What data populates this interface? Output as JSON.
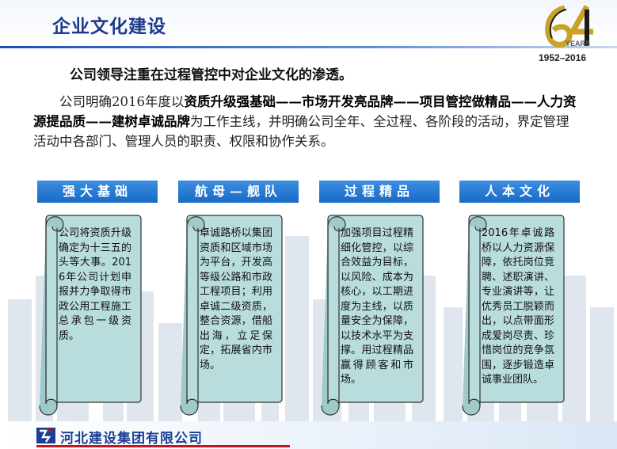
{
  "header": {
    "title": "企业文化建设",
    "years_label": "YEARS",
    "years_range": "1952–2016"
  },
  "intro": "公司领导注重在过程管控中对企业文化的渗透。",
  "paragraph": {
    "p1": "公司明确2016年度以",
    "b1": "资质升级强基础——市场开发亮品牌——项目管控做精品——人力资源提品质——建树卓诚品牌",
    "p2": "为工作主线，并明确公司全年、全过程、各阶段的活动，界定管理活动中各部门、管理人员的职责、权限和协作关系。"
  },
  "columns": [
    {
      "title": "强大基础",
      "text": "公司将资质升级确定为十三五的头等大事。2016年公司计划申报并力争取得市政公用工程施工总承包一级资质。"
    },
    {
      "title": "航母—舰队",
      "text": "卓诚路桥以集团资质和区域市场为平台，开发高等级公路和市政工程项目；利用卓诚二级资质，整合资源，借船出海，立足保定，拓展省内市场。"
    },
    {
      "title": "过程精品",
      "text": "加强项目过程精细化管控，以综合效益为目标，以风险、成本为核心，以工期进度为主线，以质量安全为保障，以技术水平为支撑。用过程精品赢得顾客和市场。"
    },
    {
      "title": "人本文化",
      "text": "2016年卓诚路桥以人力资源保障，依托岗位竞聘、述职演讲、专业演讲等，让优秀员工脱颖而出，以点带面形成爱岗尽责、珍惜岗位的竞争氛围，逐步锻造卓诚事业团队。"
    }
  ],
  "footer": {
    "company": "河北建设集团有限公司"
  },
  "colors": {
    "title_blue": "#1e3a8a",
    "column_head": "#1769c6",
    "scroll_fill": "#b9dcdc",
    "footer_red": "#c4161c"
  }
}
